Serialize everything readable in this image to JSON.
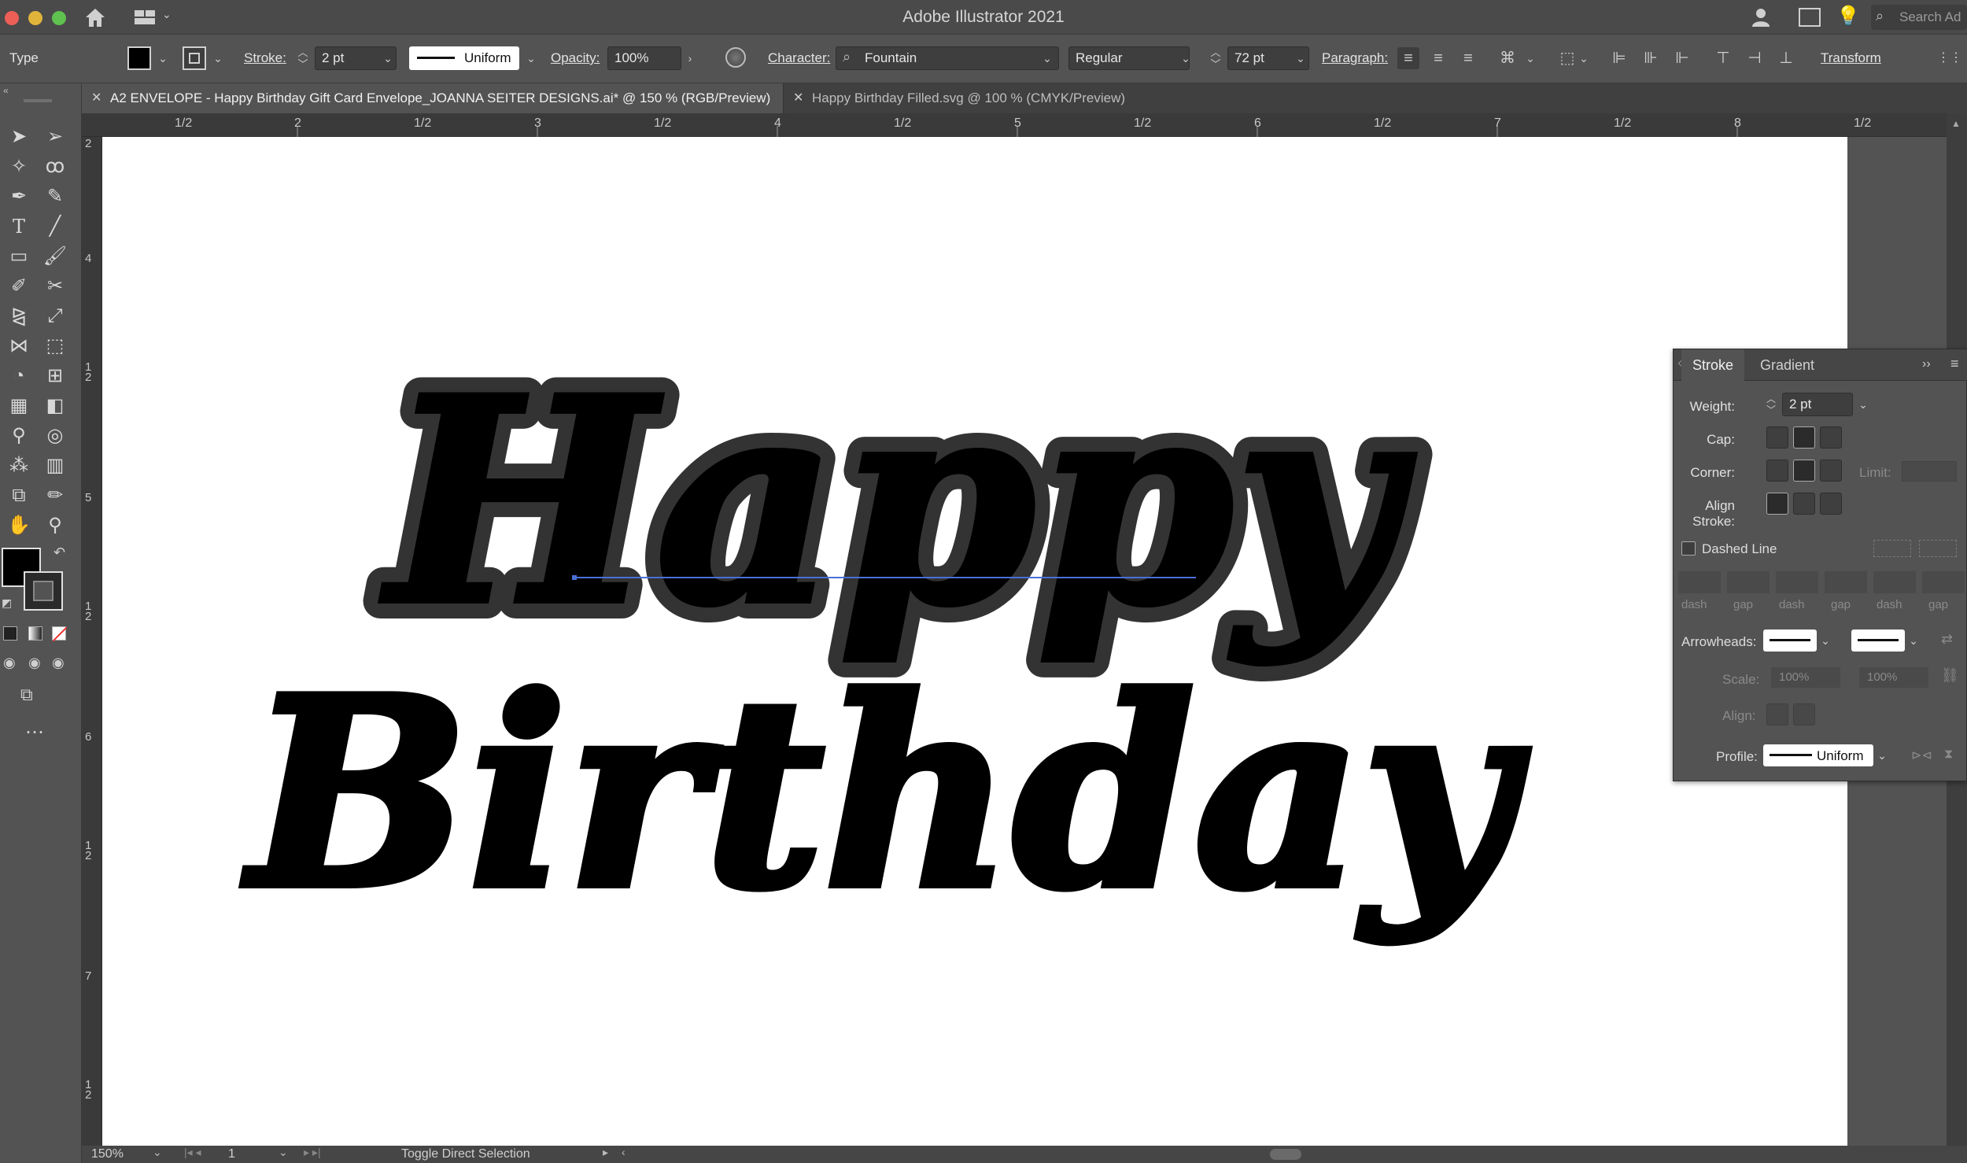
{
  "app": {
    "title": "Adobe Illustrator 2021",
    "search_placeholder": "Search Ad"
  },
  "controlbar": {
    "mode_label": "Type",
    "stroke_label": "Stroke:",
    "stroke_value": "2 pt",
    "profile_value": "Uniform",
    "opacity_label": "Opacity:",
    "opacity_value": "100%",
    "character_label": "Character:",
    "font_family": "Fountain",
    "font_style": "Regular",
    "font_size": "72 pt",
    "paragraph_label": "Paragraph:",
    "transform_label": "Transform"
  },
  "tabs": [
    {
      "label": "A2 ENVELOPE - Happy Birthday Gift Card Envelope_JOANNA SEITER DESIGNS.ai* @ 150 % (RGB/Preview)",
      "active": true
    },
    {
      "label": "Happy Birthday Filled.svg @ 100 % (CMYK/Preview)",
      "active": false
    }
  ],
  "ruler_top": [
    "1/2",
    "2",
    "1/2",
    "3",
    "1/2",
    "4",
    "1/2",
    "5",
    "1/2",
    "6",
    "1/2",
    "7",
    "1/2",
    "8",
    "1/2"
  ],
  "ruler_left": [
    "2",
    "4",
    "1\n2",
    "5",
    "1\n2",
    "6",
    "1\n2",
    "7",
    "1\n2"
  ],
  "artwork": {
    "line1": "Happy",
    "line2": "Birthday",
    "fill": "#000000",
    "outline": "#333333",
    "baseline_color": "#4a6fd6"
  },
  "stroke_panel": {
    "tab_stroke": "Stroke",
    "tab_gradient": "Gradient",
    "weight_label": "Weight:",
    "weight_value": "2 pt",
    "cap_label": "Cap:",
    "corner_label": "Corner:",
    "limit_label": "Limit:",
    "align_stroke_label": "Align Stroke:",
    "dashed_line_label": "Dashed Line",
    "dash_gap_labels": [
      "dash",
      "gap",
      "dash",
      "gap",
      "dash",
      "gap"
    ],
    "arrowheads_label": "Arrowheads:",
    "scale_label": "Scale:",
    "scale_value_1": "100%",
    "scale_value_2": "100%",
    "align_label": "Align:",
    "profile_label": "Profile:",
    "profile_value": "Uniform"
  },
  "statusbar": {
    "zoom": "150%",
    "artboard_num": "1",
    "tool_status": "Toggle Direct Selection"
  },
  "colors": {
    "chrome": "#535353",
    "dark": "#3a3a3a",
    "accent": "#4a6fd6"
  }
}
